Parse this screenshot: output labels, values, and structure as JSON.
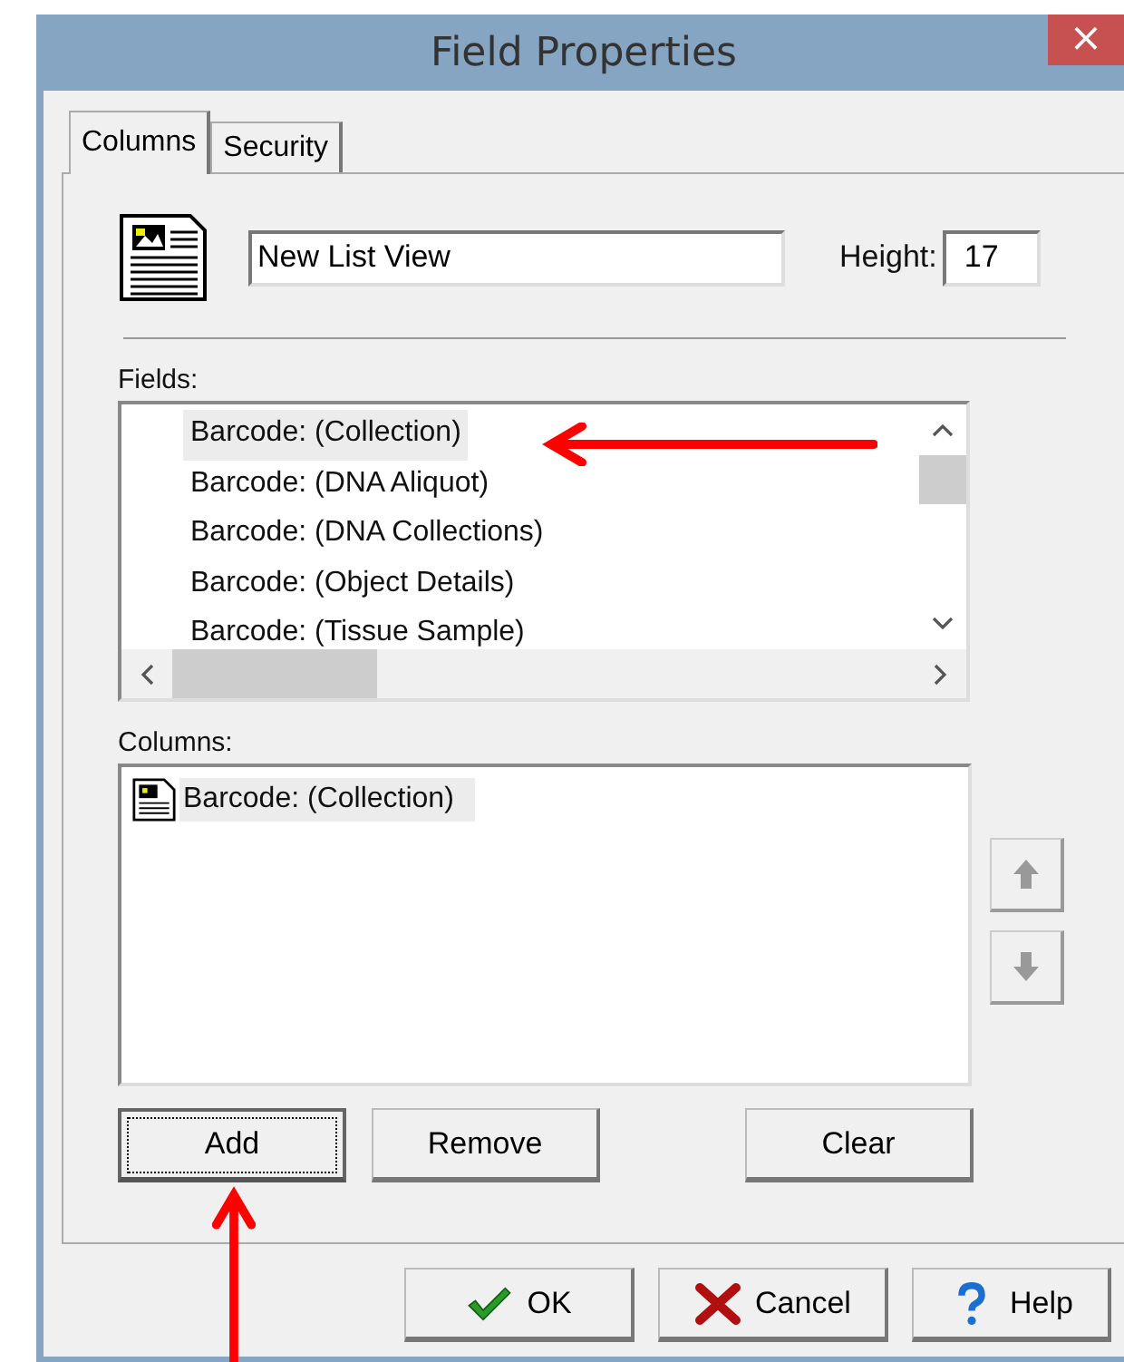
{
  "window": {
    "title": "Field Properties",
    "close": "×"
  },
  "tabs": [
    {
      "label": "Columns",
      "selected": true
    },
    {
      "label": "Security",
      "selected": false
    }
  ],
  "name_field": {
    "value": "New List View"
  },
  "height_field": {
    "label": "Height:",
    "value": "17"
  },
  "fields": {
    "label": "Fields:",
    "items": [
      {
        "label": "Barcode: (Collection)",
        "selected": true
      },
      {
        "label": "Barcode: (DNA Aliquot)",
        "selected": false
      },
      {
        "label": "Barcode: (DNA Collections)",
        "selected": false
      },
      {
        "label": "Barcode: (Object Details)",
        "selected": false
      },
      {
        "label": "Barcode: (Tissue Sample)",
        "selected": false
      }
    ]
  },
  "columns": {
    "label": "Columns:",
    "items": [
      {
        "label": "Barcode: (Collection)",
        "selected": true
      }
    ]
  },
  "list_buttons": [
    {
      "label": "Add",
      "focused": true
    },
    {
      "label": "Remove",
      "focused": false
    },
    {
      "label": "Clear",
      "focused": false
    }
  ],
  "dialog_buttons": [
    {
      "label": "OK",
      "kind": "ok"
    },
    {
      "label": "Cancel",
      "kind": "cancel"
    },
    {
      "label": "Help",
      "kind": "help"
    }
  ]
}
